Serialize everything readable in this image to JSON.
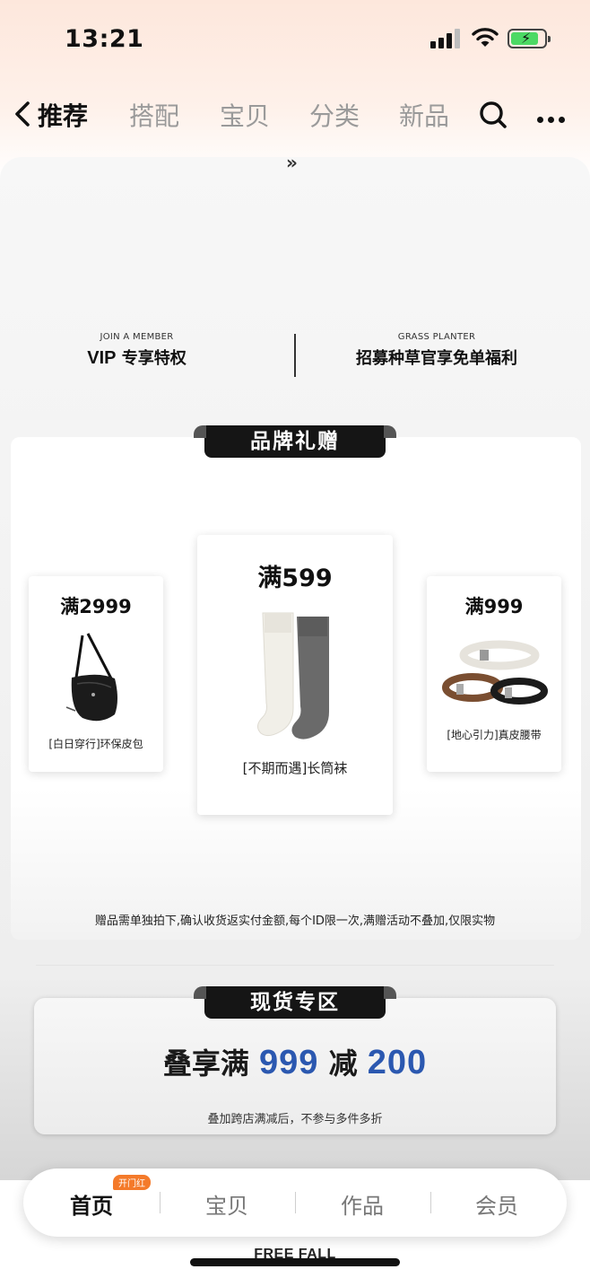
{
  "status_bar": {
    "time": "13:21"
  },
  "nav": {
    "tabs": [
      {
        "label": "推荐",
        "active": true
      },
      {
        "label": "搭配",
        "active": false
      },
      {
        "label": "宝贝",
        "active": false
      },
      {
        "label": "分类",
        "active": false
      },
      {
        "label": "新品",
        "active": false
      }
    ],
    "icons": [
      "back-icon",
      "search-icon",
      "more-icon"
    ]
  },
  "banner": {
    "expand_glyph": "»",
    "member": {
      "en": "JOIN A MEMBER",
      "vip": "VIP",
      "cn": "专享特权"
    },
    "planter": {
      "en": "GRASS PLANTER",
      "cn": "招募种草官享免单福利"
    }
  },
  "gifts": {
    "title": "品牌礼赠",
    "items": [
      {
        "threshold": "满2999",
        "name": "[白日穿行]环保皮包",
        "icon": "bag-image"
      },
      {
        "threshold": "满599",
        "name": "[不期而遇]长筒袜",
        "icon": "socks-image"
      },
      {
        "threshold": "满999",
        "name": "[地心引力]真皮腰带",
        "icon": "belt-image"
      }
    ],
    "note": "赠品需单独拍下,确认收货返实付金额,每个ID限一次,满赠活动不叠加,仅限实物"
  },
  "stock": {
    "title": "现货专区",
    "promo_prefix": "叠享满",
    "promo_amount": "999",
    "promo_mid": "减",
    "promo_discount": "200",
    "subtitle": "叠加跨店满减后，不参与多件多折",
    "accent_color": "#2b58b0"
  },
  "tabbar": {
    "items": [
      {
        "label": "首页",
        "active": true
      },
      {
        "label": "宝贝",
        "active": false
      },
      {
        "label": "作品",
        "active": false
      },
      {
        "label": "会员",
        "active": false
      }
    ],
    "badge": "开门红"
  },
  "footer_peek": "FREE FALL"
}
